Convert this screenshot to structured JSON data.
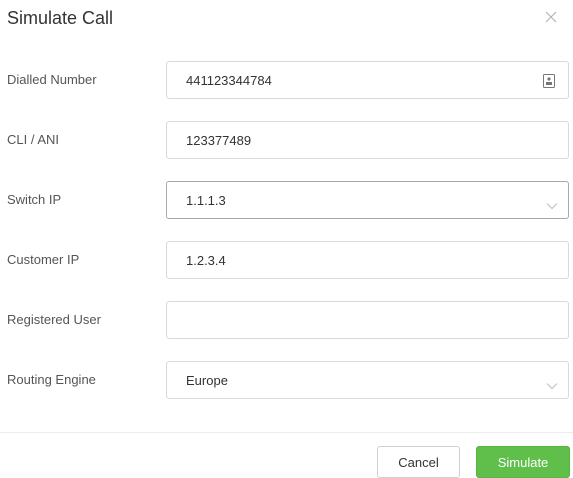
{
  "dialog": {
    "title": "Simulate Call",
    "close_icon": "close-icon"
  },
  "form": {
    "dialled_number": {
      "label": "Dialled Number",
      "value": "441123344784",
      "icon": "contact-card-icon"
    },
    "cli_ani": {
      "label": "CLI / ANI",
      "value": "123377489"
    },
    "switch_ip": {
      "label": "Switch IP",
      "value": "1.1.1.3",
      "icon": "chevron-down-icon"
    },
    "customer_ip": {
      "label": "Customer IP",
      "value": "1.2.3.4"
    },
    "registered_user": {
      "label": "Registered User",
      "value": ""
    },
    "routing_engine": {
      "label": "Routing Engine",
      "value": "Europe",
      "icon": "chevron-down-icon"
    }
  },
  "footer": {
    "cancel_label": "Cancel",
    "simulate_label": "Simulate"
  },
  "colors": {
    "primary": "#5fbf4a",
    "border": "#d9d9d9",
    "text": "#333333"
  }
}
